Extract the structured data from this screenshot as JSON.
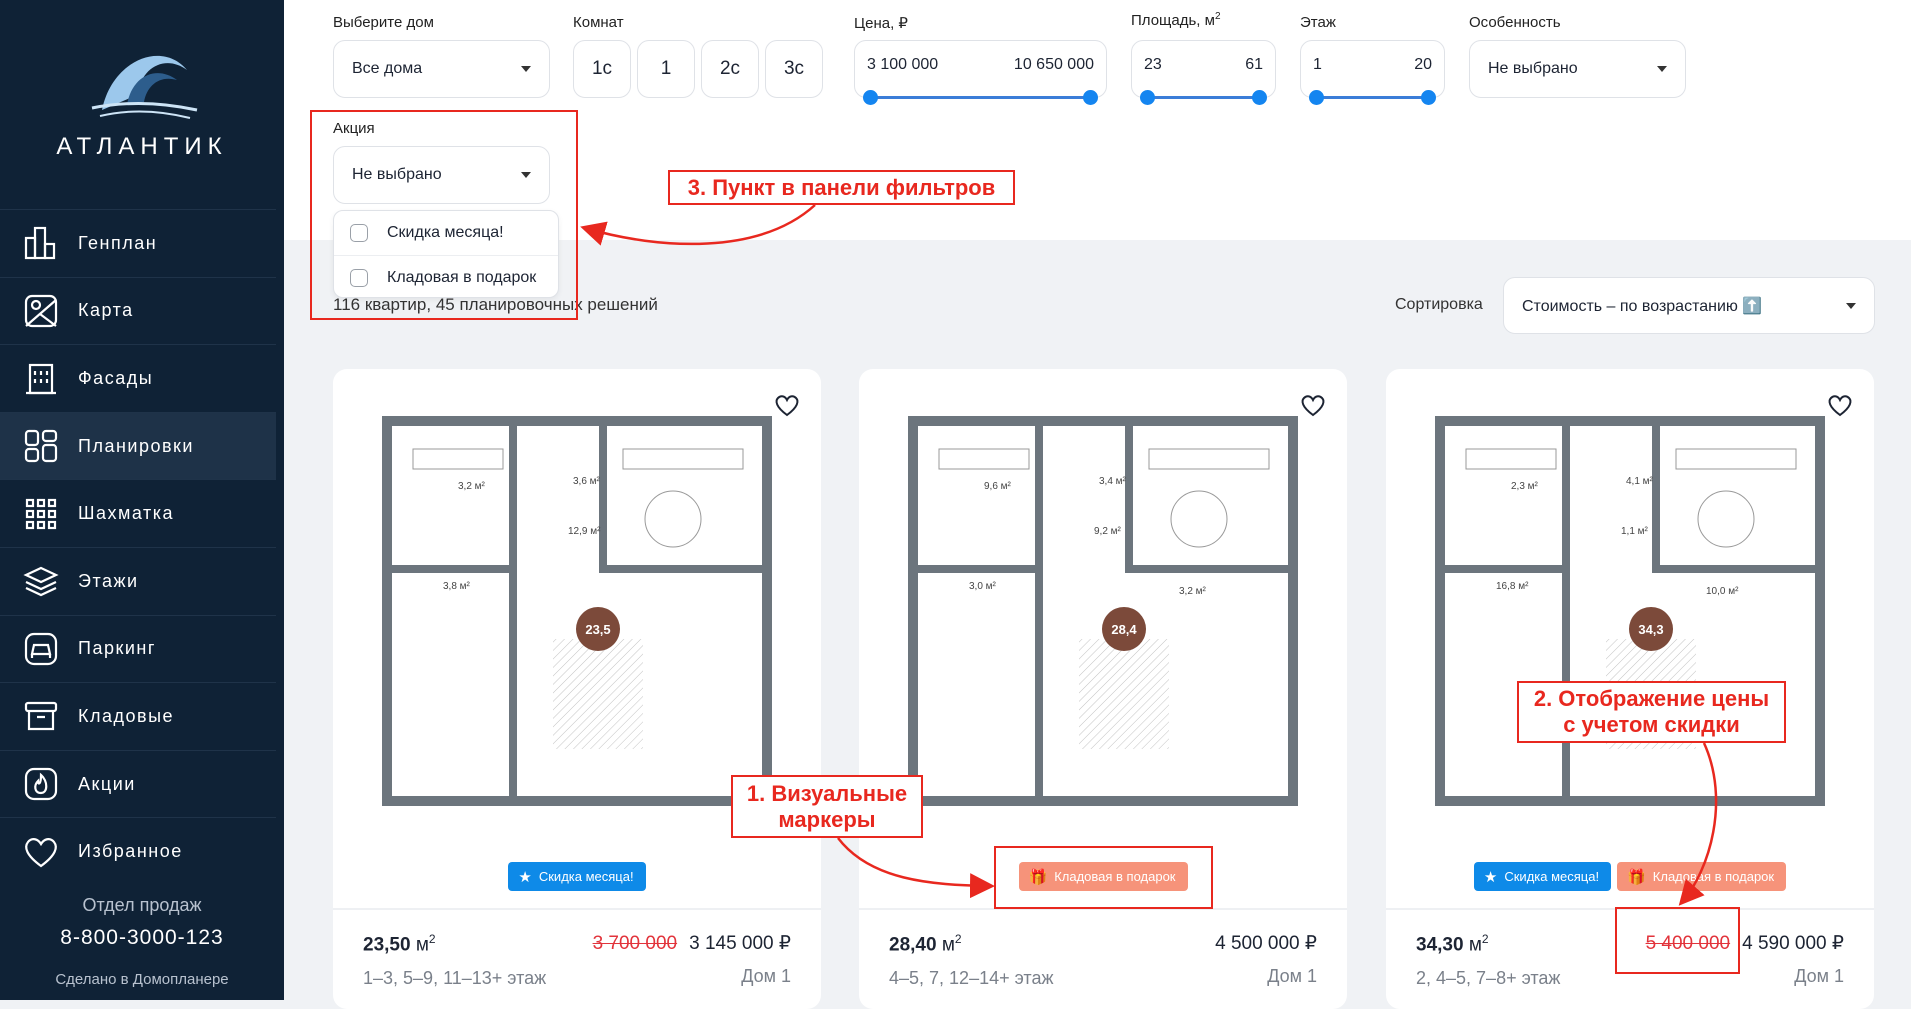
{
  "sidebar": {
    "brand": "АТЛАНТИК",
    "items": [
      {
        "label": "Генплан",
        "icon": "buildings-icon"
      },
      {
        "label": "Карта",
        "icon": "map-icon"
      },
      {
        "label": "Фасады",
        "icon": "facade-icon"
      },
      {
        "label": "Планировки",
        "icon": "layout-icon",
        "active": true
      },
      {
        "label": "Шахматка",
        "icon": "grid-icon"
      },
      {
        "label": "Этажи",
        "icon": "layers-icon"
      },
      {
        "label": "Паркинг",
        "icon": "car-icon"
      },
      {
        "label": "Кладовые",
        "icon": "box-icon"
      },
      {
        "label": "Акции",
        "icon": "fire-icon"
      },
      {
        "label": "Избранное",
        "icon": "heart-icon"
      }
    ],
    "sales_label": "Отдел продаж",
    "phone": "8-800-3000-123",
    "made_by": "Сделано в Домопланере"
  },
  "filters": {
    "house": {
      "label": "Выберите дом",
      "value": "Все дома"
    },
    "rooms": {
      "label": "Комнат",
      "options": [
        "1с",
        "1",
        "2с",
        "3с"
      ]
    },
    "price": {
      "label": "Цена, ₽",
      "min": "3 100 000",
      "max": "10 650 000"
    },
    "area": {
      "label": "Площадь, м",
      "sup": "2",
      "min": "23",
      "max": "61"
    },
    "floor": {
      "label": "Этаж",
      "min": "1",
      "max": "20"
    },
    "feature": {
      "label": "Особенность",
      "value": "Не выбрано"
    },
    "promo": {
      "label": "Акция",
      "value": "Не выбрано",
      "options": [
        "Скидка месяца!",
        "Кладовая в подарок"
      ]
    }
  },
  "results": {
    "count": "116 квартир, 45 планировочных решений",
    "sort_label": "Сортировка",
    "sort_value": "Стоимость – по возрастанию ⬆️"
  },
  "cards": [
    {
      "area": "23,50",
      "unit": "м",
      "old_price": "3 700 000",
      "price": "3 145 000 ₽",
      "floors": "1–3, 5–9, 11–13+ этаж",
      "house": "Дом 1",
      "marker": "23,5",
      "rooms": [
        "3,2 м²",
        "3,6 м²",
        "12,9 м²",
        "3,8 м²"
      ],
      "badges": [
        {
          "label": "Скидка месяца!",
          "type": "blue",
          "icon": "star-icon"
        }
      ]
    },
    {
      "area": "28,40",
      "unit": "м",
      "old_price": "",
      "price": "4 500 000 ₽",
      "floors": "4–5, 7, 12–14+ этаж",
      "house": "Дом 1",
      "marker": "28,4",
      "rooms": [
        "9,6 м²",
        "3,4 м²",
        "9,2 м²",
        "3,0 м²",
        "3,2 м²"
      ],
      "badges": [
        {
          "label": "Кладовая в подарок",
          "type": "peach",
          "icon": "gift-icon"
        }
      ]
    },
    {
      "area": "34,30",
      "unit": "м",
      "old_price": "5 400 000",
      "price": "4 590 000 ₽",
      "floors": "2, 4–5, 7–8+ этаж",
      "house": "Дом 1",
      "marker": "34,3",
      "rooms": [
        "2,3 м²",
        "4,1 м²",
        "1,1 м²",
        "16,8 м²",
        "10,0 м²"
      ],
      "badges": [
        {
          "label": "Скидка месяца!",
          "type": "blue",
          "icon": "star-icon"
        },
        {
          "label": "Кладовая в подарок",
          "type": "peach",
          "icon": "gift-icon"
        }
      ]
    }
  ],
  "annotations": {
    "filter_panel": "3. Пункт в панели фильтров",
    "markers_1": "1. Визуальные",
    "markers_2": "маркеры",
    "price_1": "2. Отображение цены",
    "price_2": "с учетом скидки"
  },
  "colors": {
    "sidebar": "#0f2236",
    "accent": "#1485f0",
    "badge_blue": "#0e8ae8",
    "badge_peach": "#f6937a",
    "old_price": "#e2333b",
    "annotation": "#e8281f",
    "marker": "#7c4a3a"
  }
}
